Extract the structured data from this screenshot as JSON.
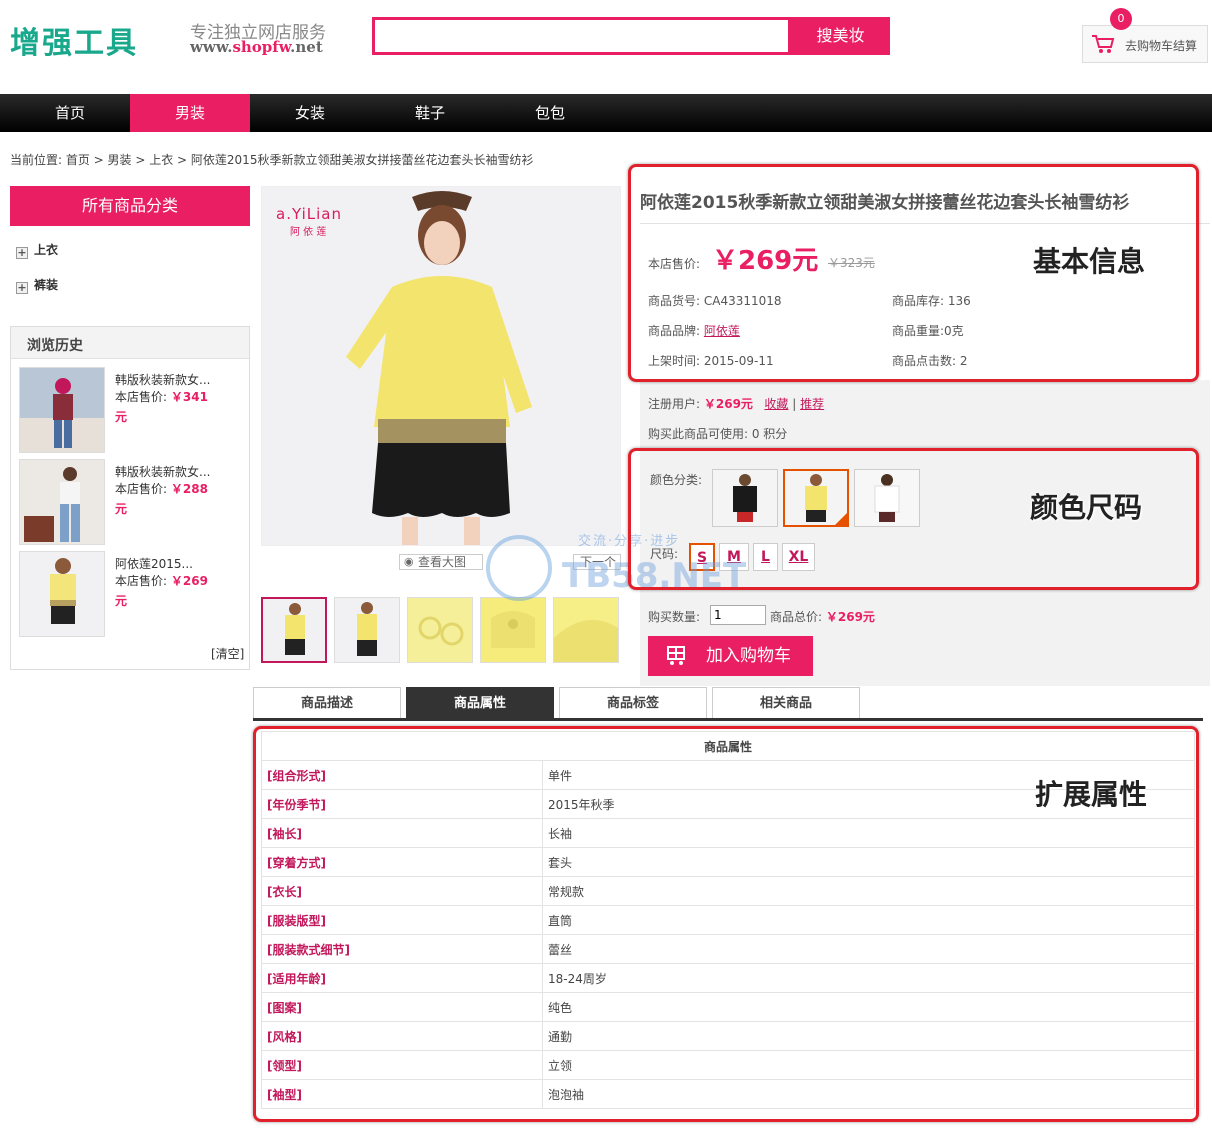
{
  "header": {
    "logo_main": "增强工具",
    "logo_sub1": "专注独立网店服务",
    "logo_sub2_prefix": "www.",
    "logo_sub2_accent": "shopfw",
    "logo_sub2_suffix": ".net",
    "search_placeholder": "",
    "search_button": "搜美妆",
    "cart_count": "0",
    "cart_label": "去购物车结算"
  },
  "nav": {
    "items": [
      "首页",
      "男装",
      "女装",
      "鞋子",
      "包包"
    ],
    "active_index": 1
  },
  "breadcrumb": "当前位置: 首页 > 男装 > 上衣 > 阿依莲2015秋季新款立领甜美淑女拼接蕾丝花边套头长袖雪纺衫",
  "sidebar": {
    "category_title": "所有商品分类",
    "categories": [
      "上衣",
      "裤装"
    ],
    "history_title": "浏览历史",
    "history": [
      {
        "title": "韩版秋装新款女...",
        "price_label": "本店售价:",
        "price": "￥341",
        "unit": "元"
      },
      {
        "title": "韩版秋装新款女...",
        "price_label": "本店售价:",
        "price": "￥288",
        "unit": "元"
      },
      {
        "title": "阿依莲2015...",
        "price_label": "本店售价:",
        "price": "￥269",
        "unit": "元"
      }
    ],
    "clear": "[清空]"
  },
  "gallery": {
    "brand": "a.YiLian",
    "brand_cn": "阿 依 莲",
    "zoom": "查看大图",
    "next": "下一个"
  },
  "product": {
    "title": "阿依莲2015秋季新款立领甜美淑女拼接蕾丝花边套头长袖雪纺衫",
    "price_label": "本店售价:",
    "price": "￥269元",
    "market_price": "￥323元",
    "sku_label": "商品货号:",
    "sku": "CA43311018",
    "stock_label": "商品库存:",
    "stock": "136",
    "brand_label": "商品品牌:",
    "brand": "阿依莲",
    "weight_label": "商品重量:",
    "weight": "0克",
    "date_label": "上架时间:",
    "date": "2015-09-11",
    "clicks_label": "商品点击数:",
    "clicks": "2",
    "member_label": "注册用户:",
    "member_price": "￥269元",
    "favorite": "收藏",
    "recommend": "推荐",
    "points": "购买此商品可使用: 0 积分",
    "color_label": "颜色分类:",
    "size_label": "尺码:",
    "sizes": [
      "S",
      "M",
      "L",
      "XL"
    ],
    "qty_label": "购买数量:",
    "qty": "1",
    "total_label": "商品总价:",
    "total": "￥269元",
    "add_cart": "加入购物车"
  },
  "annotations": {
    "basic": "基本信息",
    "color_size": "颜色尺码",
    "ext": "扩展属性"
  },
  "tabs": [
    "商品描述",
    "商品属性",
    "商品标签",
    "相关商品"
  ],
  "active_tab": 1,
  "attributes": {
    "header": "商品属性",
    "rows": [
      {
        "k": "[组合形式]",
        "v": "单件"
      },
      {
        "k": "[年份季节]",
        "v": "2015年秋季"
      },
      {
        "k": "[袖长]",
        "v": "长袖"
      },
      {
        "k": "[穿着方式]",
        "v": "套头"
      },
      {
        "k": "[衣长]",
        "v": "常规款"
      },
      {
        "k": "[服装版型]",
        "v": "直筒"
      },
      {
        "k": "[服装款式细节]",
        "v": "蕾丝"
      },
      {
        "k": "[适用年龄]",
        "v": "18-24周岁"
      },
      {
        "k": "[图案]",
        "v": "纯色"
      },
      {
        "k": "[风格]",
        "v": "通勤"
      },
      {
        "k": "[领型]",
        "v": "立领"
      },
      {
        "k": "[袖型]",
        "v": "泡泡袖"
      }
    ]
  },
  "watermark": {
    "text": "TB58.NET",
    "small": "交流·分享·进步"
  }
}
